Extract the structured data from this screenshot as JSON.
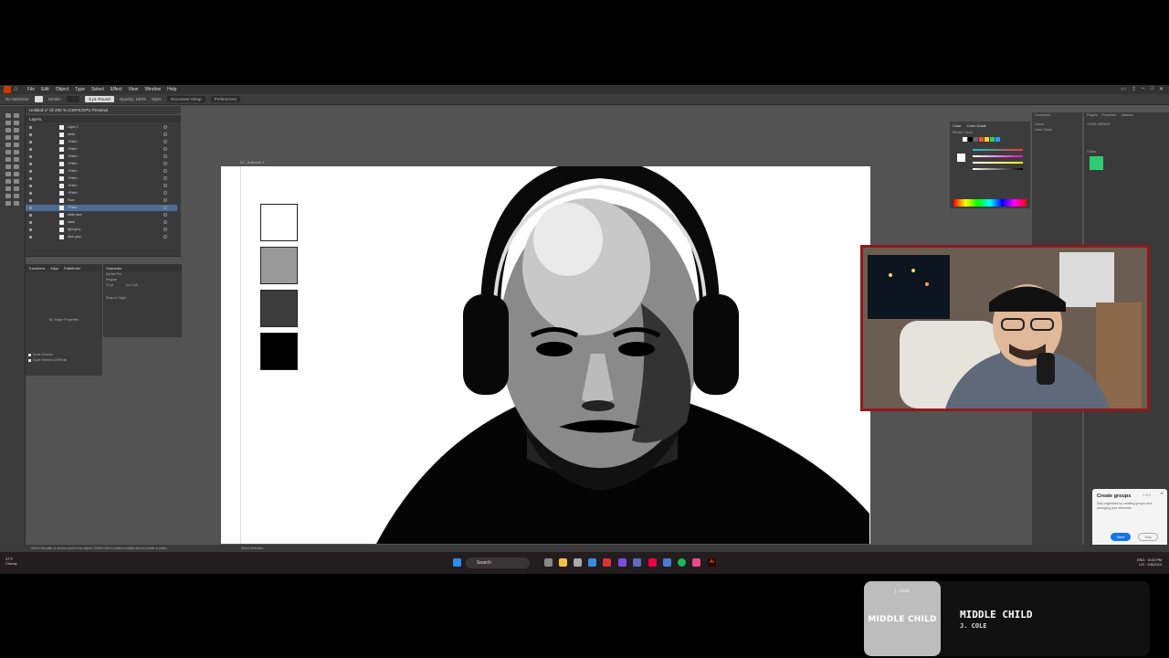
{
  "menubar": {
    "items": [
      "File",
      "Edit",
      "Object",
      "Type",
      "Select",
      "Effect",
      "View",
      "Window",
      "Help"
    ]
  },
  "controlbar": {
    "selection": "No Selection",
    "stroke": "Stroke:",
    "style": "5 pt. Round",
    "opacity": "Opacity: 100%",
    "style_label": "Style:",
    "document_setup": "Document Setup",
    "preferences": "Preferences"
  },
  "document": {
    "tab": "Untitled-1* @ 200 % (CMYK/GPU Preview)",
    "artboard_label": "01 - Artboard 1"
  },
  "layers": {
    "title": "Layers",
    "rows": [
      {
        "name": "Layer 1"
      },
      {
        "name": "white"
      },
      {
        "name": "<Path>"
      },
      {
        "name": "<Path>"
      },
      {
        "name": "<Path>"
      },
      {
        "name": "<Path>"
      },
      {
        "name": "<Path>"
      },
      {
        "name": "<Path>"
      },
      {
        "name": "<Path>"
      },
      {
        "name": "<Path>"
      },
      {
        "name": "Face"
      },
      {
        "name": "<Path>"
      },
      {
        "name": "white face"
      },
      {
        "name": "black"
      },
      {
        "name": "light grey"
      },
      {
        "name": "dark grey"
      }
    ],
    "footer": "1 Layer"
  },
  "transform_panel": {
    "tabs": [
      "Transform",
      "Align",
      "Pathfinder"
    ],
    "no_shape": "No Shape Properties",
    "scale_corners": "Scale Corners",
    "scale_strokes": "Scale Strokes & Effects"
  },
  "character_panel": {
    "tabs": [
      "Character"
    ],
    "font": "Myriad Pro",
    "style": "Regular",
    "size": "12 pt",
    "leading": "(14.4 pt)",
    "snap": "Snap to Glyph"
  },
  "color_panel": {
    "tabs": [
      "Color",
      "Color Guide"
    ],
    "recent": "Recent Colors"
  },
  "comments_panel": {
    "items": [
      "Comments",
      "Colors",
      "Color Guide"
    ]
  },
  "libraries_panel": {
    "tabs": [
      "Plugins",
      "Properties",
      "Libraries"
    ],
    "library": "YOUR LIBRARY",
    "section": "Colors"
  },
  "tooltip": {
    "title": "Create groups",
    "counter": "2 of 3",
    "description": "Stay organized by creating groups and arranging your elements.",
    "next": "Next",
    "skip": "Skip"
  },
  "statusbar": {
    "hint": "Select the path or anchor point of an object  |  Shift+Click to select multiple anchor points or paths",
    "tool": "Direct Selection"
  },
  "taskbar": {
    "weather_temp": "37°F",
    "weather_desc": "Cloudy",
    "search": "Search",
    "lang": "ENG",
    "region": "US",
    "time": "6:43 PM",
    "date": "3/5/2024"
  },
  "now_playing": {
    "title": "MIDDLE CHILD",
    "artist": "J. COLE",
    "art_text": "MIDDLE CHILD",
    "art_small": "J. COLE"
  },
  "swatches": [
    "#ffffff",
    "#9a9a9a",
    "#3d3d3d",
    "#000000"
  ],
  "colors": {
    "app_bg": "#535353",
    "panel_bg": "#3a3a3a",
    "accent": "#1473e6",
    "webcam_border": "#8e1a1a"
  }
}
